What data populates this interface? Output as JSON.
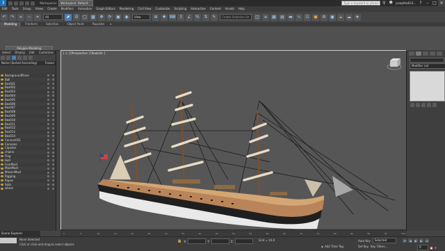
{
  "titlebar": {
    "workspace_label": "Workspaces:",
    "workspace_value": "Workspace: Default",
    "search_placeholder": "Type a keyword or phrase",
    "user": "josephtu613...",
    "help": "?"
  },
  "menu": [
    "Edit",
    "Tools",
    "Group",
    "Views",
    "Create",
    "Modifiers",
    "Animation",
    "Graph Editors",
    "Rendering",
    "Civil View",
    "Customize",
    "Scripting",
    "Interactive",
    "Content",
    "Arnold",
    "Help"
  ],
  "toolbar": {
    "filter_value": "All",
    "view_value": "View",
    "selection_set_placeholder": "Create Selection Se"
  },
  "ribbon": {
    "tabs": [
      "Modeling",
      "Freeform",
      "Selection",
      "Object Paint",
      "Populate"
    ],
    "active_tab": "Modeling",
    "panel_label": "Polygon Modeling"
  },
  "explorer": {
    "tabs": [
      "Select",
      "Display",
      "Edit",
      "Customize"
    ],
    "col_name": "Name (Sorted Ascending)",
    "col_frozen": "Frozen",
    "items": [
      "BackgroundPlane",
      "Ball",
      "Box001",
      "Box002",
      "Box003",
      "Box004",
      "Box005",
      "Box006",
      "Box007",
      "Box008",
      "Box009",
      "Box010",
      "Box011",
      "Box012",
      "Box013",
      "Box014",
      "Cannon001",
      "Cannons",
      "Capstan",
      "chains",
      "Flag",
      "Hull",
      "ForeMast",
      "MainMast",
      "MizzenMast",
      "Rigging",
      "Ropes",
      "Sails",
      "wheel"
    ],
    "footer_label": "Scene Explorer"
  },
  "viewport": {
    "label": "[ + ] [Perspective ] [Realistic ]"
  },
  "command_panel": {
    "modifier_list": "Modifier List"
  },
  "timeline": {
    "frame_ticks": [
      "0",
      "5",
      "10",
      "15",
      "20",
      "25",
      "30",
      "35",
      "40",
      "45",
      "50",
      "55",
      "60",
      "65",
      "70",
      "75",
      "80",
      "85",
      "90",
      "95",
      "100"
    ]
  },
  "status": {
    "selection": "None Selected",
    "prompt": "Click or click-and-drag to select objects",
    "time_tag": "Add Time Tag",
    "autokey": "Auto Key",
    "set_key": "Set Key",
    "selected": "Selected",
    "key_filters": "Key Filters...",
    "frame": "0",
    "coord_x_label": "X:",
    "coord_y_label": "Y:",
    "coord_z_label": "Z:",
    "grid": "Grid = 10.0"
  },
  "colors": {
    "accent": "#4a7fb5",
    "viewport_bg": "#565656",
    "hull_wood": "#b9845a",
    "sail": "#e8dcc6",
    "mast": "#7a5130"
  }
}
